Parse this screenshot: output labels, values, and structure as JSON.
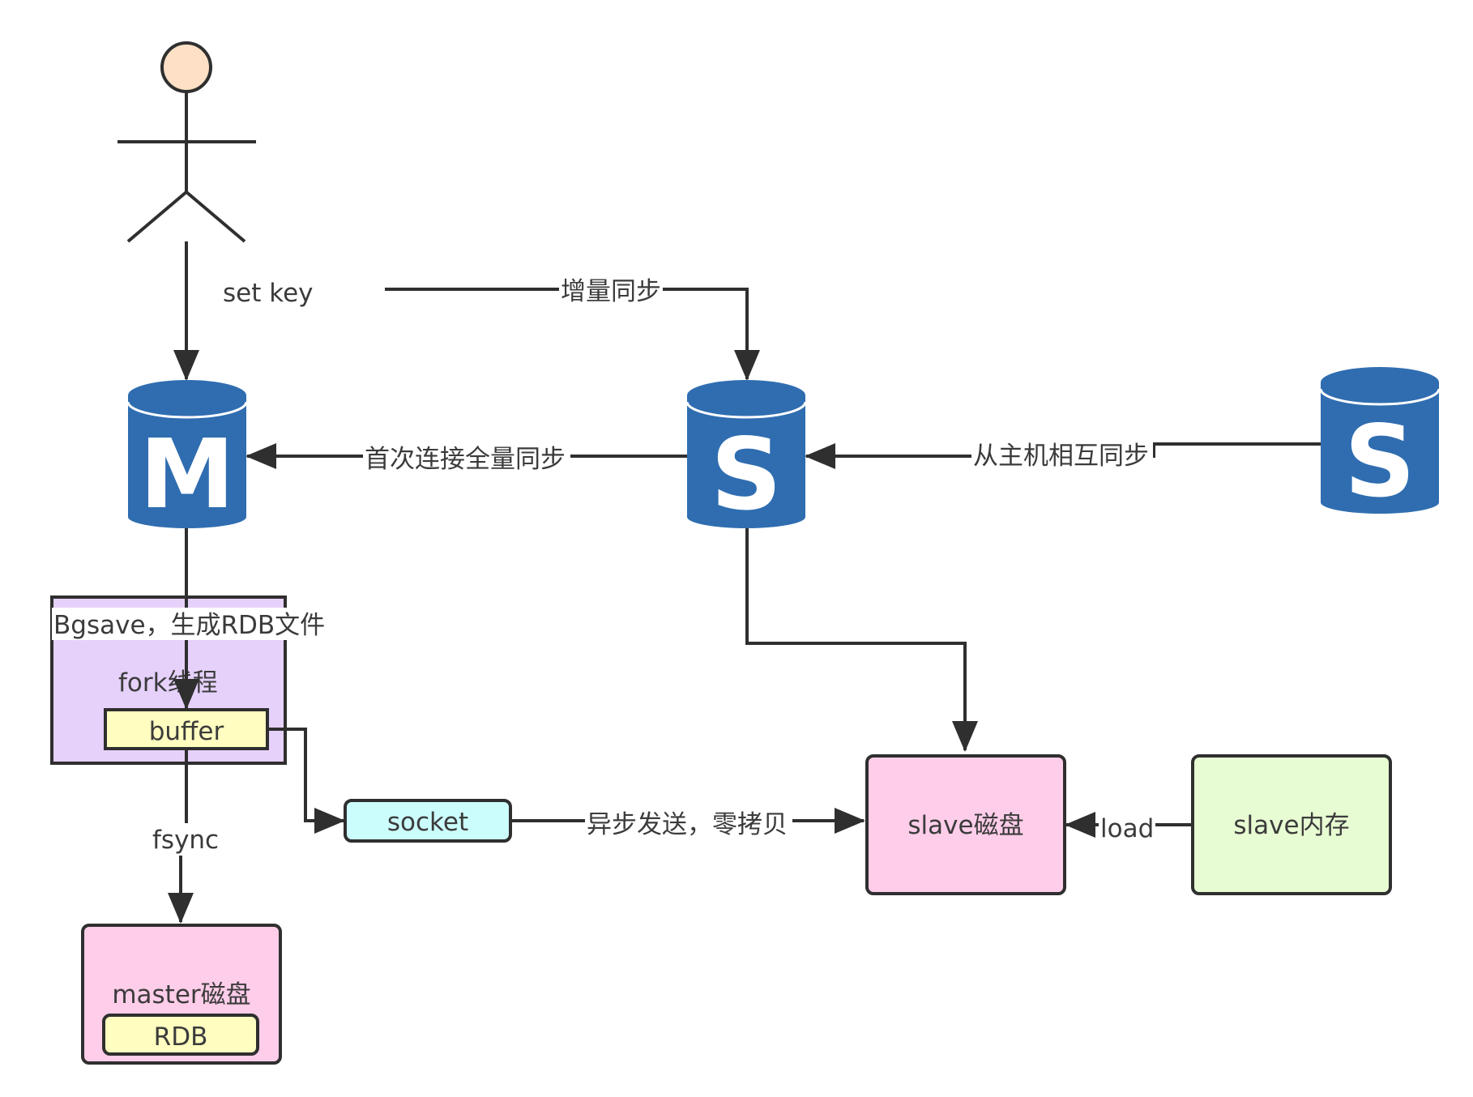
{
  "actor": {
    "label": "set key"
  },
  "databases": {
    "master": {
      "letter": "M"
    },
    "slave1": {
      "letter": "S"
    },
    "slave2": {
      "letter": "S"
    }
  },
  "edges": {
    "incremental_sync": "增量同步",
    "first_full_sync": "首次连接全量同步",
    "slave_mutual_sync": "从主机相互同步",
    "bgsave": "Bgsave，生成RDB文件",
    "fsync": "fsync",
    "async_send": "异步发送，零拷贝",
    "load": "load"
  },
  "boxes": {
    "fork_thread": "fork线程",
    "buffer": "buffer",
    "socket": "socket",
    "master_disk": "master磁盘",
    "rdb": "RDB",
    "slave_disk": "slave磁盘",
    "slave_memory": "slave内存"
  },
  "colors": {
    "db_blue": "#2f6db0",
    "fork_purple": "#e6d1fb",
    "buffer_yellow": "#fffdc0",
    "socket_cyan": "#ccfdfd",
    "disk_pink": "#fecde9",
    "memory_green": "#e7fcd2",
    "actor_head": "#fde0c6"
  }
}
